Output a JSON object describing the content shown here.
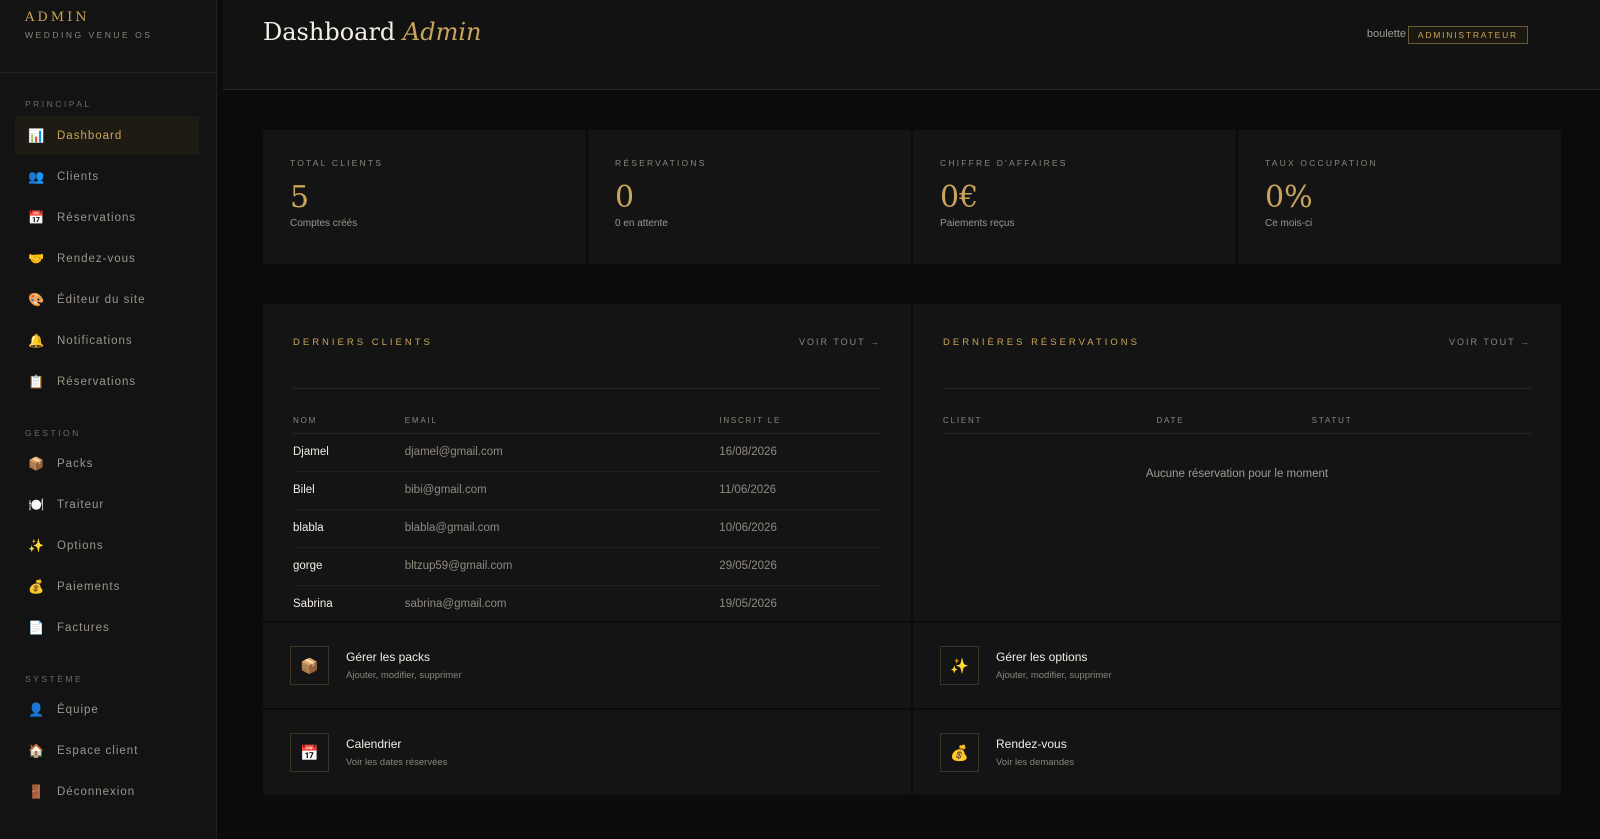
{
  "brand": {
    "title": "ADMIN",
    "subtitle": "WEDDING VENUE OS"
  },
  "sidebar": {
    "sections": [
      {
        "label": "PRINCIPAL"
      },
      {
        "label": "GESTION"
      },
      {
        "label": "SYSTÈME"
      }
    ],
    "items": [
      {
        "label": "Dashboard",
        "icon": "📊"
      },
      {
        "label": "Clients",
        "icon": "👥"
      },
      {
        "label": "Réservations",
        "icon": "📅"
      },
      {
        "label": "Rendez-vous",
        "icon": "🤝"
      },
      {
        "label": "Éditeur du site",
        "icon": "🎨"
      },
      {
        "label": "Notifications",
        "icon": "🔔"
      },
      {
        "label": "Réservations",
        "icon": "📋"
      },
      {
        "label": "Packs",
        "icon": "📦"
      },
      {
        "label": "Traiteur",
        "icon": "🍽️"
      },
      {
        "label": "Options",
        "icon": "✨"
      },
      {
        "label": "Paiements",
        "icon": "💰"
      },
      {
        "label": "Factures",
        "icon": "📄"
      },
      {
        "label": "Équipe",
        "icon": "👤"
      },
      {
        "label": "Espace client",
        "icon": "🏠"
      },
      {
        "label": "Déconnexion",
        "icon": "🚪"
      }
    ]
  },
  "header": {
    "title": "Dashboard",
    "title_accent": "Admin",
    "user": "boulette",
    "role": "ADMINISTRATEUR"
  },
  "stats": [
    {
      "label": "TOTAL CLIENTS",
      "value": "5",
      "sub": "Comptes créés"
    },
    {
      "label": "RÉSERVATIONS",
      "value": "0",
      "sub": "0 en attente"
    },
    {
      "label": "CHIFFRE D'AFFAIRES",
      "value": "0€",
      "sub": "Paiements reçus"
    },
    {
      "label": "TAUX OCCUPATION",
      "value": "0%",
      "sub": "Ce mois-ci"
    }
  ],
  "clients_panel": {
    "title": "DERNIERS CLIENTS",
    "voir": "VOIR TOUT →",
    "columns": [
      "NOM",
      "EMAIL",
      "INSCRIT LE"
    ],
    "rows": [
      {
        "name": "Djamel",
        "email": "djamel@gmail.com",
        "date": "16/08/2026"
      },
      {
        "name": "Bilel",
        "email": "bibi@gmail.com",
        "date": "11/06/2026"
      },
      {
        "name": "blabla",
        "email": "blabla@gmail.com",
        "date": "10/06/2026"
      },
      {
        "name": "gorge",
        "email": "bltzup59@gmail.com",
        "date": "29/05/2026"
      },
      {
        "name": "Sabrina",
        "email": "sabrina@gmail.com",
        "date": "19/05/2026"
      }
    ]
  },
  "reservations_panel": {
    "title": "DERNIÈRES RÉSERVATIONS",
    "voir": "VOIR TOUT →",
    "columns": [
      "CLIENT",
      "DATE",
      "STATUT"
    ],
    "empty": "Aucune réservation pour le moment"
  },
  "actions": [
    {
      "title": "Gérer les packs",
      "sub": "Ajouter, modifier, supprimer",
      "icon": "📦"
    },
    {
      "title": "Gérer les options",
      "sub": "Ajouter, modifier, supprimer",
      "icon": "✨"
    },
    {
      "title": "Calendrier",
      "sub": "Voir les dates réservées",
      "icon": "📅"
    },
    {
      "title": "Rendez-vous",
      "sub": "Voir les demandes",
      "icon": "💰"
    }
  ]
}
